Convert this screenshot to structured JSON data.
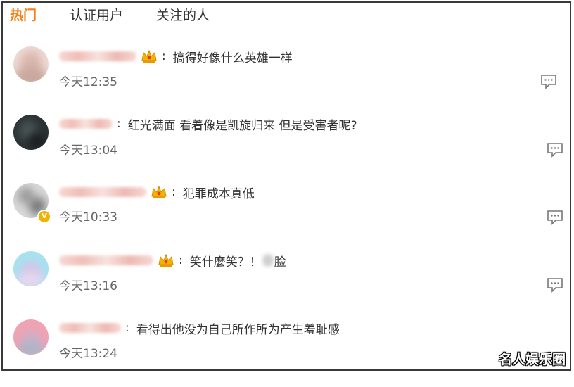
{
  "tabs": [
    {
      "label": "热门",
      "active": true
    },
    {
      "label": "认证用户",
      "active": false
    },
    {
      "label": "关注的人",
      "active": false
    }
  ],
  "comments": [
    {
      "text": "搞得好像什么英雄一样",
      "time": "今天12:35",
      "crown": true,
      "verified": false
    },
    {
      "text": "红光满面 看着像是凯旋归来 但是受害者呢?",
      "time": "今天13:04",
      "crown": false,
      "verified": false
    },
    {
      "text": "犯罪成本真低",
      "time": "今天10:33",
      "crown": true,
      "verified": true
    },
    {
      "text_before": "笑什麼笑？！",
      "text_after": "脸",
      "time": "今天13:16",
      "crown": true,
      "verified": false
    },
    {
      "text": "看得出他没为自己所作所为产生羞耻感",
      "time": "今天13:24",
      "crown": false,
      "verified": false
    }
  ],
  "watermark": "名人娱乐圈",
  "colors": {
    "accent": "#f4801a",
    "crown": "#f2b300",
    "text": "#333333",
    "muted": "#666666"
  }
}
